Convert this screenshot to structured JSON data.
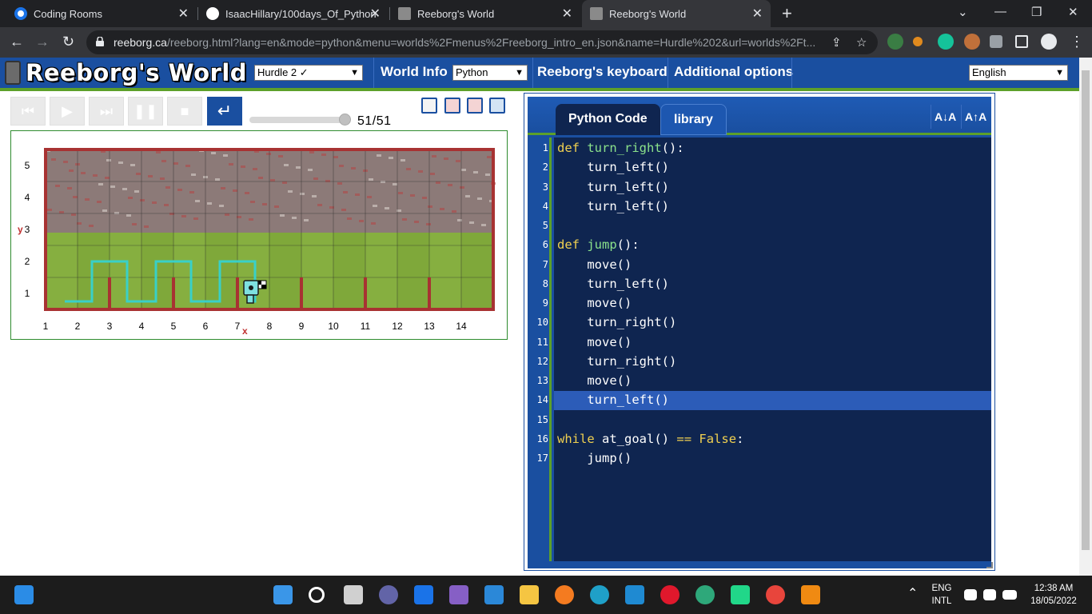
{
  "browser": {
    "tabs": [
      {
        "title": "Coding Rooms",
        "active": false
      },
      {
        "title": "IsaacHillary/100days_Of_Python",
        "active": false
      },
      {
        "title": "Reeborg's World",
        "active": false
      },
      {
        "title": "Reeborg's World",
        "active": true
      }
    ],
    "url_domain": "reeborg.ca",
    "url_path": "/reeborg.html?lang=en&mode=python&menu=worlds%2Fmenus%2Freeborg_intro_en.json&name=Hurdle%202&url=worlds%2Ft...",
    "icons": {
      "back": "←",
      "forward": "→",
      "reload": "↻",
      "new_tab": "+",
      "minimize": "—",
      "restore": "❐",
      "close": "✕",
      "share": "⇪",
      "star": "☆",
      "menu": "⋮",
      "dropdown": "⌄"
    }
  },
  "header": {
    "logo": "Reeborg's World",
    "world_select": "Hurdle 2 ✓",
    "world_info": "World Info",
    "mode_select": "Python",
    "keyboard": "Reeborg's keyboard",
    "options": "Additional options",
    "language": "English"
  },
  "controls": {
    "step_counter": "51/51"
  },
  "world": {
    "y_label": "y",
    "x_label": "x",
    "x_ticks": [
      "1",
      "2",
      "3",
      "4",
      "5",
      "6",
      "7",
      "8",
      "9",
      "10",
      "11",
      "12",
      "13",
      "14"
    ],
    "y_ticks": [
      "1",
      "2",
      "3",
      "4",
      "5"
    ],
    "hurdle_columns": [
      2,
      4,
      6,
      8,
      10,
      12
    ],
    "robot_position": {
      "x": 7,
      "y": 1
    },
    "goal_position": {
      "x": 7,
      "y": 1
    },
    "colors": {
      "wall": "#a83232",
      "trace": "#39d0c8",
      "grid": "#2a2a2a"
    }
  },
  "editor": {
    "tabs": [
      "Python Code",
      "library"
    ],
    "font_decrease": "A↓A",
    "font_increase": "A↑A",
    "highlighted_line": 14,
    "lines": [
      "def turn_right():",
      "    turn_left()",
      "    turn_left()",
      "    turn_left()",
      "",
      "def jump():",
      "    move()",
      "    turn_left()",
      "    move()",
      "    turn_right()",
      "    move()",
      "    turn_right()",
      "    move()",
      "    turn_left()",
      "",
      "while at_goal() == False:",
      "    jump()"
    ]
  },
  "taskbar": {
    "lang_line1": "ENG",
    "lang_line2": "INTL",
    "time": "12:38 AM",
    "date": "18/05/2022"
  }
}
